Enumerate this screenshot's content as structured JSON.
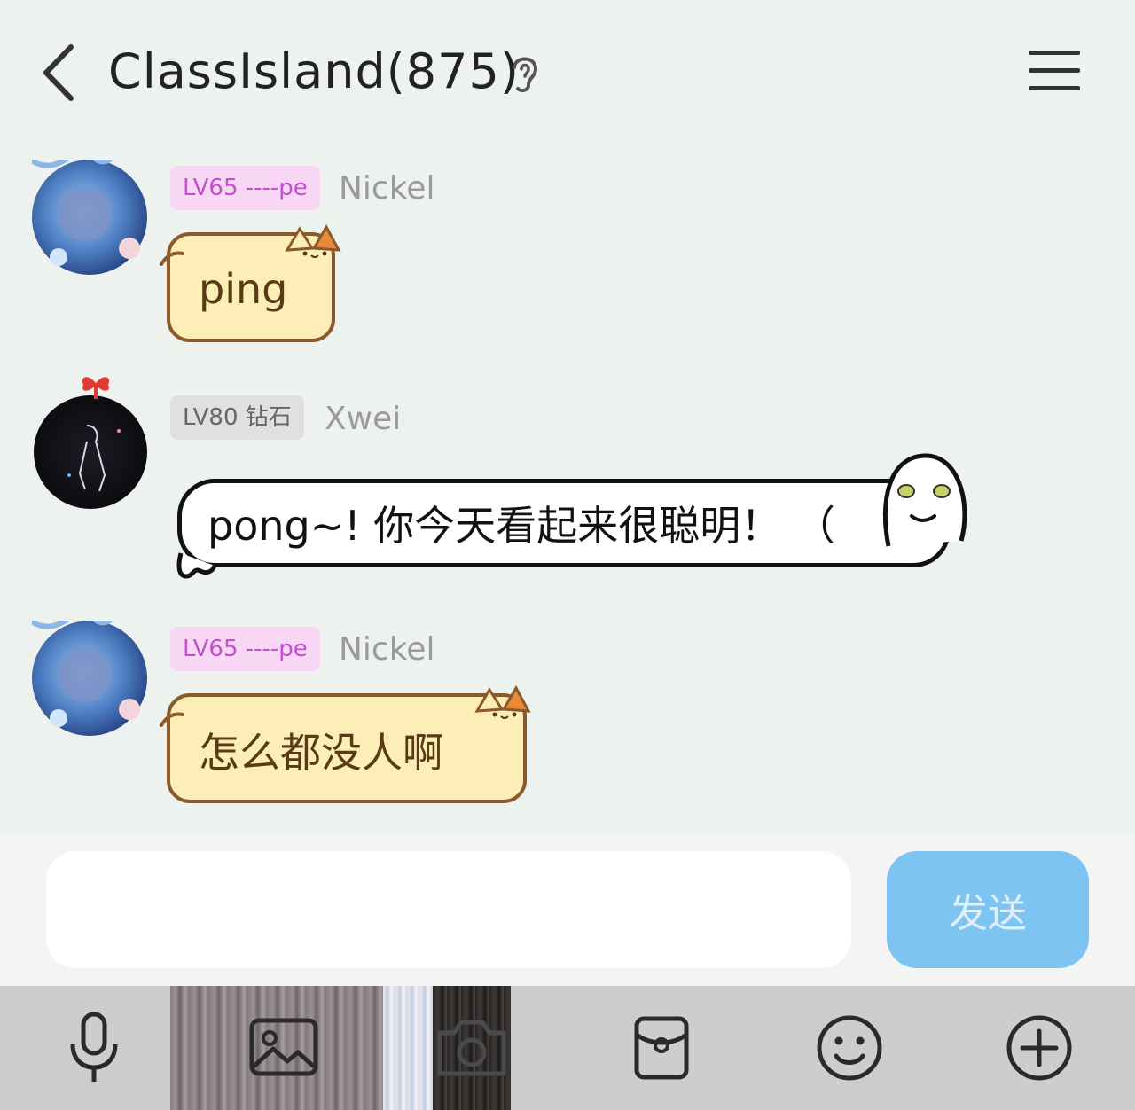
{
  "header": {
    "title": "ClassIsland(875)",
    "back_icon": "chevron-left-icon",
    "ear_icon": "ear-icon",
    "menu_icon": "hamburger-menu-icon"
  },
  "messages": [
    {
      "badge": "LV65 ----pe",
      "sender": "Nickel",
      "text": "ping",
      "bubble_style": "cat"
    },
    {
      "badge": "LV80 钻石",
      "sender": "Xwei",
      "text": "pong~! 你今天看起来很聪明！ （",
      "bubble_style": "white-ghost"
    },
    {
      "badge": "LV65 ----pe",
      "sender": "Nickel",
      "text": "怎么都没人啊",
      "bubble_style": "cat"
    }
  ],
  "composer": {
    "input_value": "",
    "send_label": "发送"
  },
  "toolbar": {
    "items": [
      "microphone-icon",
      "image-icon",
      "camera-icon",
      "red-packet-icon",
      "smiley-icon",
      "plus-circle-icon"
    ]
  },
  "colors": {
    "background": "#eef2ef",
    "send_button": "#7ec4f2",
    "badge_pink_bg": "#f8d7f5",
    "badge_pink_text": "#c24fcf",
    "cat_bubble": "#fdeeb8",
    "toolbar_bg": "#cdcdcd"
  }
}
